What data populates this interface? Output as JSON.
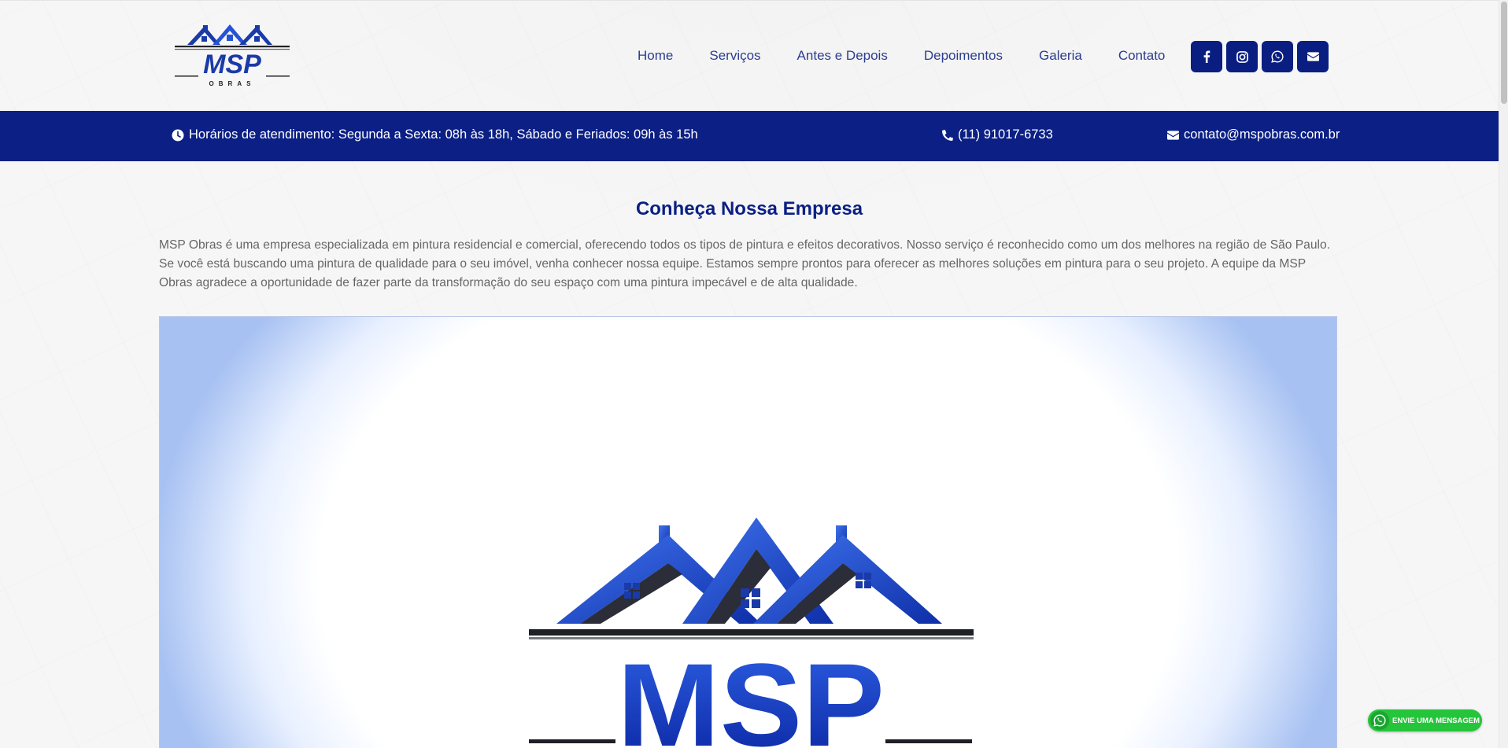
{
  "brand": {
    "logo_main": "MSP",
    "logo_sub": "OBRAS"
  },
  "nav": {
    "items": [
      {
        "label": "Home"
      },
      {
        "label": "Serviços"
      },
      {
        "label": "Antes e Depois"
      },
      {
        "label": "Depoimentos"
      },
      {
        "label": "Galeria"
      },
      {
        "label": "Contato"
      }
    ]
  },
  "social": [
    "facebook-icon",
    "instagram-icon",
    "whatsapp-icon",
    "envelope-icon"
  ],
  "infobar": {
    "hours": "Horários de atendimento: Segunda a Sexta: 08h às 18h, Sábado e Feriados: 09h às 15h",
    "phone": "(11) 91017-6733",
    "email": "contato@mspobras.com.br"
  },
  "about": {
    "title": "Conheça Nossa Empresa",
    "text": "MSP Obras é uma empresa especializada em pintura residencial e comercial, oferecendo todos os tipos de pintura e efeitos decorativos. Nosso serviço é reconhecido como um dos melhores na região de São Paulo. Se você está buscando uma pintura de qualidade para o seu imóvel, venha conhecer nossa equipe. Estamos sempre prontos para oferecer as melhores soluções em pintura para o seu projeto. A equipe da MSP Obras agradece a oportunidade de fazer parte da transformação do seu espaço com uma pintura impecável e de alta qualidade."
  },
  "whatsapp_chip": {
    "label": "ENVIE UMA MENSAGEM"
  },
  "colors": {
    "primary": "#0b1f85",
    "nav_text": "#2c3d8f",
    "whatsapp": "#25c53b"
  }
}
